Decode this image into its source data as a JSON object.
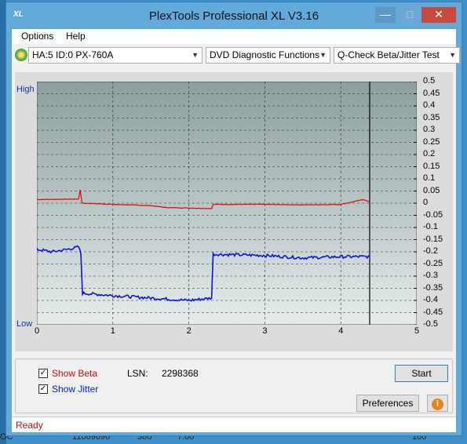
{
  "window": {
    "title": "PlexTools Professional XL V3.16",
    "icon_label": "XL"
  },
  "menu": [
    "Options",
    "Help"
  ],
  "toolbar": {
    "drive": "HA:5 ID:0  PX-760A",
    "function": "DVD Diagnostic Functions",
    "test": "Q-Check Beta/Jitter Test"
  },
  "chart_legend": {
    "high": "High",
    "low": "Low"
  },
  "chart_data": {
    "type": "line",
    "x_ticks": [
      "0",
      "1",
      "2",
      "3",
      "4",
      "5"
    ],
    "y_ticks": [
      "0.5",
      "0.45",
      "0.4",
      "0.35",
      "0.3",
      "0.25",
      "0.2",
      "0.15",
      "0.1",
      "0.05",
      "0",
      "-0.05",
      "-0.1",
      "-0.15",
      "-0.2",
      "-0.25",
      "-0.3",
      "-0.35",
      "-0.4",
      "-0.45",
      "-0.5"
    ],
    "xlim": [
      0,
      5
    ],
    "ylim": [
      -0.5,
      0.5
    ],
    "grid": true,
    "end_marker_x": 4.38,
    "series": [
      {
        "color": "#e01010",
        "x": [
          0,
          0.55,
          0.57,
          0.59,
          0.6,
          1.0,
          1.5,
          1.7,
          2.0,
          2.3,
          2.32,
          3.0,
          3.5,
          4.0,
          4.3,
          4.38
        ],
        "y": [
          0.015,
          0.017,
          0.055,
          0.008,
          0.0,
          -0.005,
          -0.01,
          -0.018,
          -0.02,
          -0.022,
          -0.005,
          -0.005,
          -0.007,
          -0.005,
          0.015,
          0.005
        ]
      },
      {
        "color": "#1010e0",
        "x": [
          0,
          0.2,
          0.4,
          0.55,
          0.58,
          0.6,
          1.0,
          1.5,
          2.0,
          2.3,
          2.32,
          3.0,
          3.5,
          4.0,
          4.38
        ],
        "y": [
          -0.19,
          -0.2,
          -0.19,
          -0.18,
          -0.21,
          -0.37,
          -0.38,
          -0.39,
          -0.4,
          -0.39,
          -0.21,
          -0.215,
          -0.225,
          -0.22,
          -0.22
        ]
      }
    ]
  },
  "controls": {
    "show_beta": "Show Beta",
    "show_jitter": "Show Jitter",
    "lsn_label": "LSN:",
    "lsn_value": "2298368",
    "start": "Start",
    "preferences": "Preferences"
  },
  "status": "Ready",
  "background_text": [
    "11069696",
    "380",
    "7.00",
    "100"
  ]
}
